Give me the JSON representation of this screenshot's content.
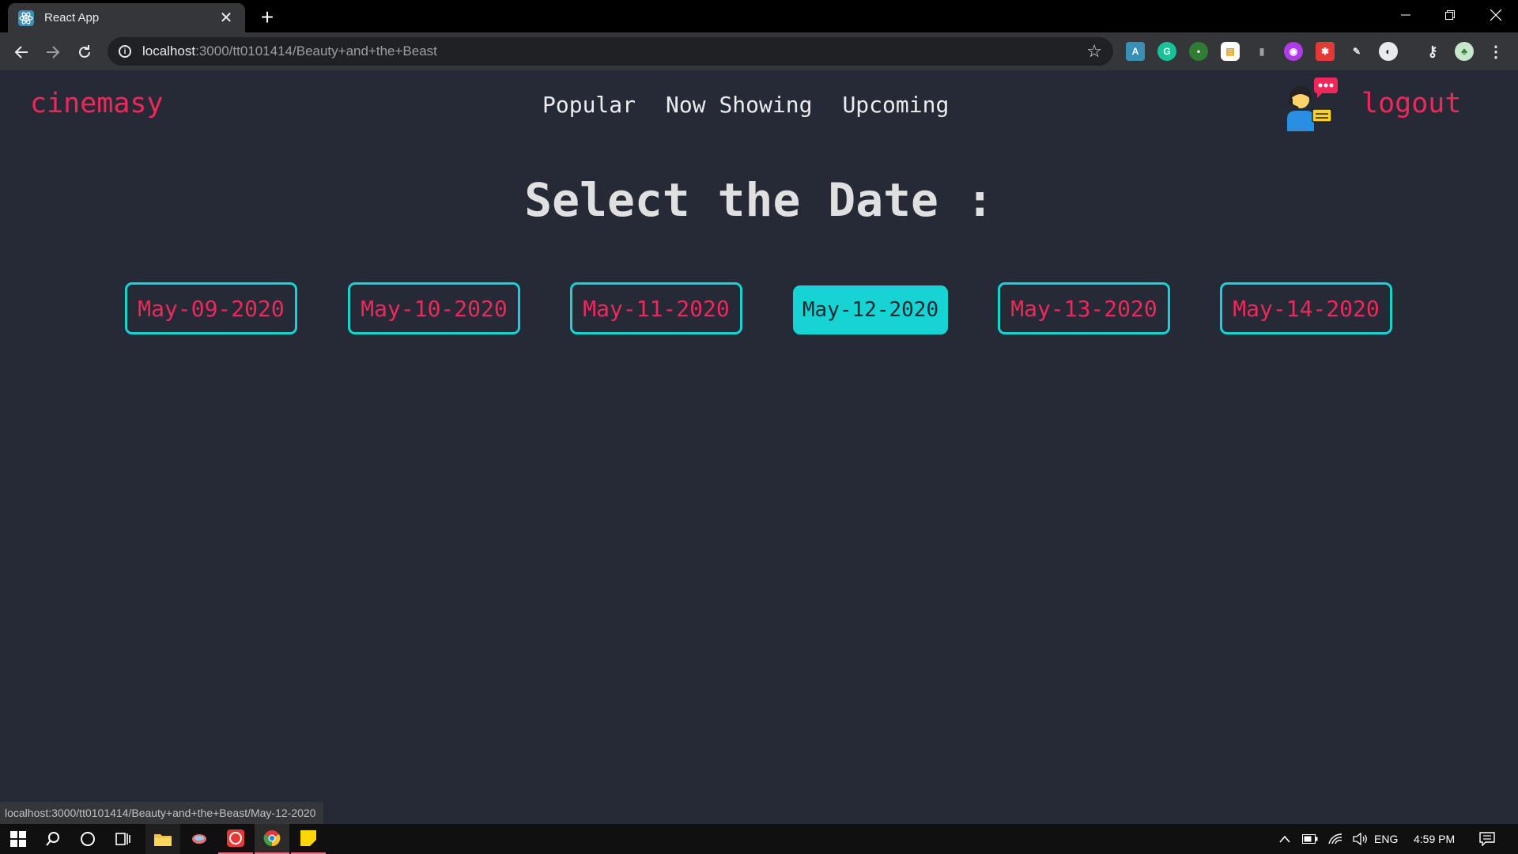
{
  "browser": {
    "tab_title": "React App",
    "url_host": "localhost",
    "url_path": ":3000/tt0101414/Beauty+and+the+Beast",
    "status_url": "localhost:3000/tt0101414/Beauty+and+the+Beast/May-12-2020"
  },
  "app": {
    "brand": "cinemasy",
    "nav": [
      "Popular",
      "Now Showing",
      "Upcoming"
    ],
    "logout": "logout",
    "heading": "Select the Date :",
    "dates": [
      "May-09-2020",
      "May-10-2020",
      "May-11-2020",
      "May-12-2020",
      "May-13-2020",
      "May-14-2020"
    ],
    "selected_date": "May-12-2020"
  },
  "taskbar": {
    "language": "ENG",
    "time": "4:59 PM"
  },
  "colors": {
    "accent": "#f0285a",
    "teal": "#16d4d4",
    "background": "#252a36"
  }
}
